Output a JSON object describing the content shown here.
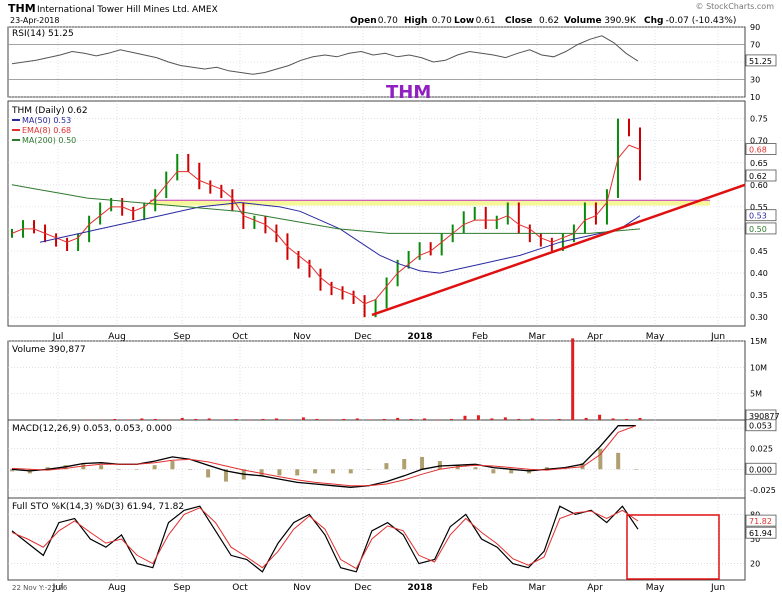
{
  "header": {
    "symbol": "THM",
    "company": "International Tower Hill Mines Ltd.",
    "exchange": "AMEX",
    "date": "23-Apr-2018",
    "watermark": "© StockCharts.com",
    "open_label": "Open",
    "open": "0.70",
    "high_label": "High",
    "high": "0.70",
    "low_label": "Low",
    "low": "0.61",
    "close_label": "Close",
    "close": "0.62",
    "volume_label": "Volume",
    "volume": "390.9K",
    "chg_label": "Chg",
    "chg": "-0.07 (-10.43%)"
  },
  "annotation_text": "THM",
  "x_ticks": [
    "Jul",
    "Aug",
    "Sep",
    "Oct",
    "Nov",
    "Dec",
    "2018",
    "Feb",
    "Mar",
    "Apr",
    "May",
    "Jun"
  ],
  "colors": {
    "price_up": "#0a8a0a",
    "price_down": "#cc0000",
    "ema": "#e23030",
    "ma50": "#2a2aa0",
    "ma200": "#2f7a2f",
    "trendline": "#e01010",
    "band": "#f5f58a",
    "annotation": "#9020c0",
    "volume": "#e02020",
    "macd_hist": "#b0a070"
  },
  "chart_data": [
    {
      "type": "line",
      "panel": "rsi",
      "title": "RSI(14)",
      "value_label": "51.25",
      "ylim": [
        10,
        90
      ],
      "yticks": [
        "90",
        "70",
        "50",
        "30",
        "10"
      ],
      "levels": [
        70,
        30
      ],
      "series": [
        {
          "values": [
            48,
            50,
            52,
            55,
            58,
            62,
            60,
            57,
            60,
            64,
            61,
            58,
            55,
            50,
            46,
            44,
            42,
            44,
            40,
            38,
            36,
            38,
            42,
            46,
            52,
            56,
            58,
            56,
            60,
            62,
            58,
            60,
            56,
            58,
            55,
            50,
            52,
            58,
            62,
            60,
            58,
            55,
            60,
            64,
            58,
            56,
            62,
            70,
            76,
            80,
            72,
            60,
            51
          ]
        }
      ]
    },
    {
      "type": "line",
      "panel": "price",
      "title": "THM (Daily)",
      "value_label": "0.62",
      "ylim": [
        0.28,
        0.79
      ],
      "yticks": [
        "0.75",
        "0.70",
        "0.65",
        "0.60",
        "0.55",
        "0.50",
        "0.45",
        "0.40",
        "0.35",
        "0.30"
      ],
      "series": [
        {
          "name": "THM (Daily)",
          "values": [
            0.49,
            0.51,
            0.5,
            0.48,
            0.47,
            0.46,
            0.48,
            0.52,
            0.55,
            0.56,
            0.54,
            0.53,
            0.55,
            0.58,
            0.62,
            0.66,
            0.64,
            0.6,
            0.59,
            0.58,
            0.55,
            0.51,
            0.52,
            0.5,
            0.48,
            0.44,
            0.42,
            0.4,
            0.37,
            0.36,
            0.35,
            0.34,
            0.31,
            0.33,
            0.38,
            0.42,
            0.44,
            0.46,
            0.45,
            0.48,
            0.5,
            0.53,
            0.54,
            0.51,
            0.52,
            0.55,
            0.5,
            0.48,
            0.47,
            0.46,
            0.48,
            0.5,
            0.55,
            0.52,
            0.58,
            0.74,
            0.72,
            0.62
          ]
        },
        {
          "name": "MA(50)",
          "value": "0.53",
          "values": [
            0.47,
            0.48,
            0.49,
            0.5,
            0.51,
            0.52,
            0.53,
            0.54,
            0.55,
            0.555,
            0.56,
            0.555,
            0.55,
            0.54,
            0.52,
            0.5,
            0.47,
            0.44,
            0.42,
            0.405,
            0.4,
            0.41,
            0.42,
            0.43,
            0.44,
            0.455,
            0.47,
            0.48,
            0.49,
            0.5,
            0.53
          ]
        },
        {
          "name": "EMA(8)",
          "value": "0.68",
          "values": [
            0.49,
            0.5,
            0.5,
            0.49,
            0.48,
            0.47,
            0.48,
            0.51,
            0.53,
            0.55,
            0.55,
            0.54,
            0.55,
            0.57,
            0.6,
            0.63,
            0.63,
            0.61,
            0.6,
            0.59,
            0.57,
            0.53,
            0.52,
            0.51,
            0.49,
            0.46,
            0.44,
            0.42,
            0.39,
            0.37,
            0.36,
            0.35,
            0.33,
            0.34,
            0.37,
            0.4,
            0.42,
            0.44,
            0.45,
            0.47,
            0.49,
            0.51,
            0.52,
            0.52,
            0.52,
            0.53,
            0.51,
            0.5,
            0.48,
            0.47,
            0.48,
            0.49,
            0.52,
            0.53,
            0.56,
            0.66,
            0.69,
            0.68
          ]
        },
        {
          "name": "MA(200)",
          "value": "0.50",
          "values": [
            0.6,
            0.59,
            0.58,
            0.57,
            0.565,
            0.56,
            0.555,
            0.55,
            0.545,
            0.54,
            0.53,
            0.52,
            0.51,
            0.5,
            0.495,
            0.49,
            0.49,
            0.49,
            0.49,
            0.49,
            0.49,
            0.49,
            0.49,
            0.49,
            0.495,
            0.5
          ]
        }
      ],
      "levels": [
        {
          "name": "resistance-band",
          "from": 0.553,
          "to": 0.565
        }
      ],
      "trendline": {
        "from": {
          "x": "Dec",
          "y": 0.305
        },
        "to": {
          "x": "May",
          "y": 0.56
        }
      }
    },
    {
      "type": "bar",
      "panel": "volume",
      "title": "Volume",
      "value_label": "390,877",
      "value_box": "390877",
      "ylim": [
        0,
        15
      ],
      "yticks": [
        "15M",
        "10M",
        "5M"
      ],
      "values_m": [
        0.1,
        0.1,
        0.2,
        0.1,
        0.3,
        0.2,
        0.1,
        0.4,
        0.2,
        0.3,
        0.1,
        0.2,
        0.1,
        0.2,
        0.3,
        0.1,
        0.5,
        0.2,
        0.1,
        0.2,
        0.3,
        0.1,
        0.2,
        0.4,
        0.2,
        0.3,
        0.1,
        0.2,
        0.8,
        0.9,
        0.3,
        0.5,
        0.2,
        0.3,
        0.1,
        0.2,
        15.5,
        0.4,
        1.0,
        0.3,
        0.2,
        0.39
      ]
    },
    {
      "type": "line",
      "panel": "macd",
      "title": "MACD(12,26,9)",
      "value_label": "0.053, 0.053, 0.000",
      "value_box": "0.053",
      "value_box2": "0.000",
      "ylim": [
        -0.035,
        0.06
      ],
      "yticks": [
        "0.050",
        "0.025",
        "0.000",
        "-0.025"
      ],
      "series": [
        {
          "name": "MACD",
          "values": [
            0.0,
            -0.002,
            0.0,
            0.003,
            0.007,
            0.008,
            0.006,
            0.006,
            0.01,
            0.015,
            0.012,
            0.005,
            -0.002,
            -0.006,
            -0.008,
            -0.012,
            -0.016,
            -0.018,
            -0.02,
            -0.022,
            -0.02,
            -0.015,
            -0.008,
            0.0,
            0.004,
            0.005,
            0.006,
            0.002,
            0.0,
            -0.002,
            0.0,
            0.002,
            0.006,
            0.028,
            0.053,
            0.053
          ]
        },
        {
          "name": "Signal",
          "values": [
            0.001,
            0.0,
            -0.001,
            0.001,
            0.004,
            0.006,
            0.006,
            0.006,
            0.008,
            0.011,
            0.012,
            0.009,
            0.004,
            -0.001,
            -0.005,
            -0.009,
            -0.013,
            -0.016,
            -0.018,
            -0.02,
            -0.02,
            -0.018,
            -0.013,
            -0.006,
            0.0,
            0.003,
            0.005,
            0.004,
            0.002,
            0.0,
            -0.001,
            0.001,
            0.003,
            0.018,
            0.045,
            0.053
          ]
        }
      ]
    },
    {
      "type": "line",
      "panel": "sto",
      "title": "Full STO %K(14,3) %D(3)",
      "value_label": "61.94, 71.82",
      "value_box": "61.94",
      "value_box2": "71.82",
      "ylim": [
        0,
        100
      ],
      "yticks": [
        "80",
        "50",
        "20"
      ],
      "x_label_left": "22 Nov Y:-22.76",
      "series": [
        {
          "name": "%K",
          "values": [
            60,
            45,
            30,
            70,
            75,
            50,
            40,
            55,
            20,
            15,
            70,
            85,
            90,
            60,
            30,
            25,
            10,
            45,
            70,
            80,
            55,
            15,
            10,
            60,
            70,
            55,
            20,
            25,
            65,
            80,
            50,
            40,
            20,
            15,
            35,
            90,
            80,
            85,
            70,
            90,
            62
          ]
        },
        {
          "name": "%D",
          "values": [
            58,
            50,
            40,
            60,
            72,
            58,
            45,
            50,
            30,
            20,
            55,
            80,
            88,
            70,
            40,
            28,
            15,
            35,
            62,
            78,
            62,
            25,
            14,
            50,
            66,
            60,
            30,
            22,
            55,
            75,
            58,
            44,
            26,
            18,
            28,
            75,
            82,
            84,
            75,
            85,
            72
          ]
        }
      ]
    }
  ]
}
